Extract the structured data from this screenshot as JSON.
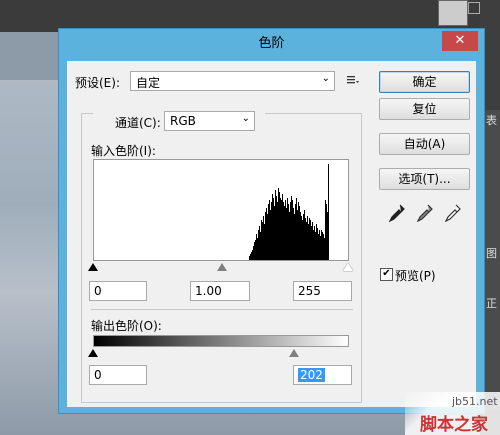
{
  "dialog": {
    "title": "色阶",
    "preset_label": "预设(E):",
    "preset_value": "自定",
    "channel_label": "通道(C):",
    "channel_value": "RGB",
    "input_levels_label": "输入色阶(I):",
    "input_black": "0",
    "input_gamma": "1.00",
    "input_white": "255",
    "output_levels_label": "输出色阶(O):",
    "output_black": "0",
    "output_white": "202",
    "buttons": {
      "ok": "确定",
      "reset": "复位",
      "auto": "自动(A)",
      "options": "选项(T)..."
    },
    "preview_label": "预览(P)",
    "preview_checked": true
  },
  "watermark": {
    "url": "jb51.net",
    "name": "脚本之家"
  },
  "histogram": {
    "bins_start": 155,
    "values": [
      4,
      6,
      8,
      10,
      14,
      18,
      20,
      26,
      22,
      30,
      34,
      28,
      40,
      38,
      44,
      36,
      48,
      52,
      46,
      56,
      60,
      50,
      58,
      66,
      62,
      54,
      70,
      64,
      58,
      72,
      68,
      62,
      60,
      66,
      58,
      54,
      60,
      52,
      62,
      56,
      48,
      58,
      64,
      60,
      52,
      46,
      56,
      62,
      50,
      58,
      54,
      48,
      44,
      40,
      46,
      50,
      42,
      38,
      44,
      36,
      42,
      40,
      34,
      38,
      30,
      34,
      28,
      36,
      32,
      26,
      30,
      24,
      30,
      28,
      26,
      22,
      60,
      56,
      48,
      96
    ]
  }
}
